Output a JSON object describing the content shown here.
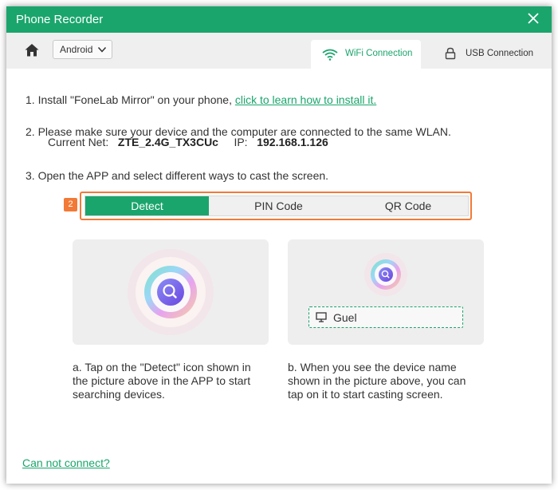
{
  "window": {
    "title": "Phone Recorder"
  },
  "toolbar": {
    "platform": "Android"
  },
  "tabs": {
    "wifi": "WiFi Connection",
    "usb": "USB Connection"
  },
  "steps": {
    "s1_text": "1. Install \"FoneLab Mirror\" on your phone,",
    "s1_link": "click to learn how to install it.",
    "s2": "2. Please make sure your device and the computer are connected to the same WLAN.",
    "net_label": "Current Net:",
    "net_value": "ZTE_2.4G_TX3CUc",
    "ip_label": "IP:",
    "ip_value": "192.168.1.126",
    "s3": "3. Open the APP and select different ways to cast the screen."
  },
  "badge": "2",
  "segments": [
    "Detect",
    "PIN Code",
    "QR Code"
  ],
  "device_name": "Guel",
  "descriptions": {
    "a": "a. Tap on the \"Detect\" icon shown in the picture above in the APP to start searching devices.",
    "b": "b. When you see the device name shown in the picture above, you can tap on it to start casting screen."
  },
  "footer_link": "Can not connect?",
  "colors": {
    "accent": "#1aa56c",
    "highlight": "#f27a36"
  },
  "icons": [
    "home-icon",
    "chevron-down-icon",
    "wifi-icon",
    "lock-icon",
    "close-icon",
    "monitor-icon",
    "detect-search-icon"
  ]
}
